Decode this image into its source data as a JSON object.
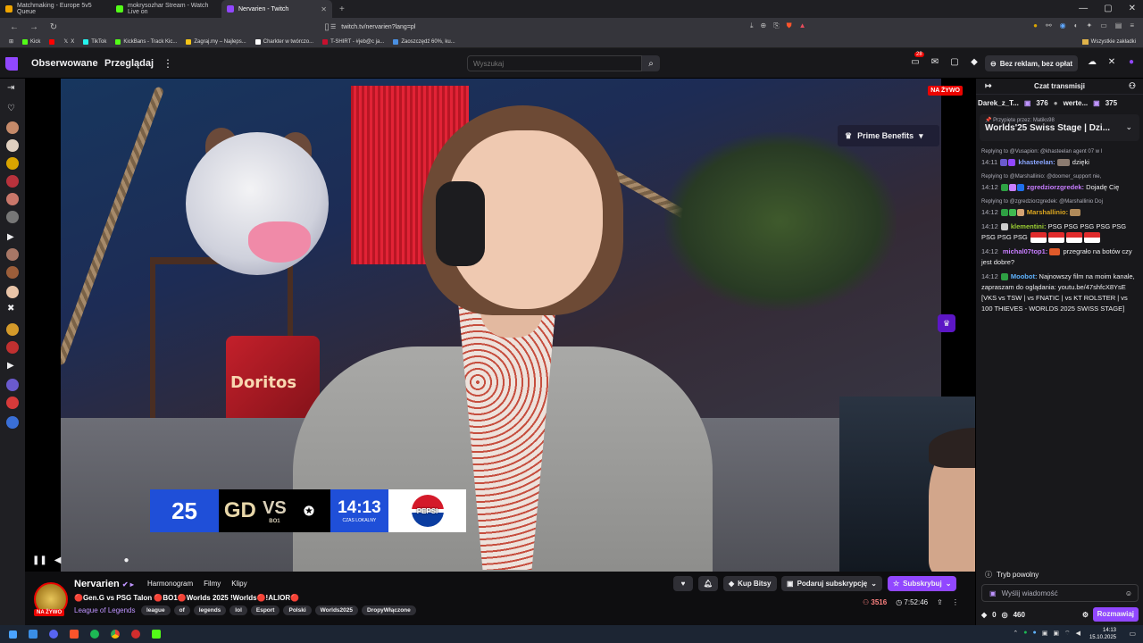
{
  "browser": {
    "tabs": [
      {
        "title": "Matchmaking - Europe 5v5 Queue",
        "color": "#f0a500",
        "active": false
      },
      {
        "title": "mokrysozhar Stream - Watch Live on",
        "color": "#53fc18",
        "active": false
      },
      {
        "title": "Nervarien - Twitch",
        "color": "#9147ff",
        "active": true
      }
    ],
    "new_tab": "+",
    "url": "twitch.tv/nervarien?lang=pl",
    "bookmarks": [
      {
        "label": "Kick",
        "color": "#53fc18"
      },
      {
        "label": "",
        "color": "#ff0000"
      },
      {
        "label": "X",
        "color": "#ffffff"
      },
      {
        "label": "TikTok",
        "color": "#25f4ee"
      },
      {
        "label": "KickBans - Track Kic...",
        "color": "#53fc18"
      },
      {
        "label": "Zagraj.my – Najleps...",
        "color": "#f5c518"
      },
      {
        "label": "Charkter w twórczo...",
        "color": "#ffffff"
      },
      {
        "label": "T-SHIRT - #jeb@c ja...",
        "color": "#c8102e"
      },
      {
        "label": "Zaoszczędź 60%, ku...",
        "color": "#4a90e2"
      }
    ],
    "bookmarks_all": "Wszystkie zakładki"
  },
  "twitch_nav": {
    "following": "Obserwowane",
    "browse": "Przeglądaj",
    "search_placeholder": "Wyszukaj",
    "notifications_count": "28",
    "no_ads": "Bez reklam, bez opłat"
  },
  "player": {
    "live_label": "NA ŻYWO",
    "prime_benefits": "Prime Benefits",
    "scoreboard": {
      "event": "25",
      "team1": "GD",
      "vs": "VS",
      "format": "BO1",
      "time": "14:13",
      "time_label": "CZAS LOKALNY",
      "sponsor": "PEPSI"
    },
    "background_text": "Doritos"
  },
  "stream": {
    "channel": "Nervarien",
    "tabs": [
      "Harmonogram",
      "Filmy",
      "Klipy"
    ],
    "title": "🔴Gen.G vs PSG Talon 🔴BO1🔴Worlds 2025 !Worlds🔴!ALIOR🔴",
    "category": "League of Legends",
    "tags": [
      "league",
      "of",
      "legends",
      "lol",
      "Esport",
      "Polski",
      "Worlds2025",
      "DropyWłączone"
    ],
    "live_badge": "NA ŻYWO",
    "buy_bits": "Kup Bitsy",
    "gift_sub": "Podaruj subskrypcję",
    "subscribe": "Subskrybuj",
    "viewers": "3516",
    "uptime": "7:52:46"
  },
  "chat": {
    "header": "Czat transmisji",
    "leaderboard": [
      {
        "name": "Darek_z_T...",
        "value": "376"
      },
      {
        "name": "werte...",
        "value": "375"
      }
    ],
    "pinned_by": "Przypięte przez: Matiks98",
    "pinned_title": "Worlds'25 Swiss Stage | Dzi...",
    "messages": [
      {
        "reply": "Replying to @Vusapion: @khasteelan agent 07 w l",
        "time": "14:11",
        "user": "khasteelan:",
        "color": "#8aa6ff",
        "text": "dzięki"
      },
      {
        "reply": "Replying to @Marshallinio: @doomer_support nie,",
        "time": "14:12",
        "user": "zgredziorzgredek:",
        "color": "#c77dff",
        "text": "Dojadę Cię"
      },
      {
        "reply": "Replying to @zgredziorzgredek: @Marshallinio Doj",
        "time": "14:12",
        "user": "Marshallinio:",
        "color": "#daa520",
        "text": ""
      },
      {
        "reply": "",
        "time": "14:12",
        "user": "klementini:",
        "color": "#9acd32",
        "text": "PSG PSG PSG PSG PSG PSG PSG PSG"
      },
      {
        "reply": "",
        "time": "14:12",
        "user": "michal07top1:",
        "color": "#c77dff",
        "text": "przegrało na botów czy jest dobre?"
      },
      {
        "reply": "",
        "time": "14:12",
        "user": "Moobot:",
        "color": "#5fb3ff",
        "text": "Najnowszy film na moim kanale, zapraszam do oglądania: youtu.be/47shfcX8YsE [VKS vs TSW | vs FNATIC | vs KT ROLSTER | vs 100 THIEVES - WORLDS 2025 SWISS STAGE]"
      }
    ],
    "slow_mode": "Tryb powolny",
    "input_placeholder": "Wyślij wiadomość",
    "points_a": "0",
    "points_b": "460",
    "send": "Rozmawiaj"
  },
  "taskbar": {
    "time": "14:13",
    "date": "15.10.2025"
  }
}
